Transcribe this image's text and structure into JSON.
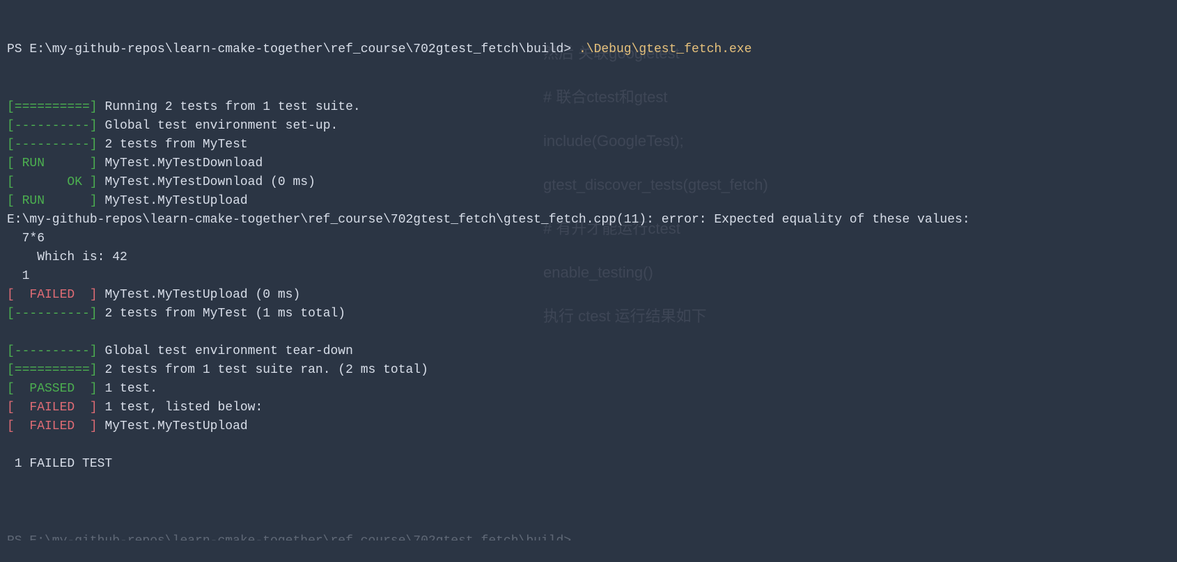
{
  "prompt": {
    "shell": "PS",
    "path": "E:\\my-github-repos\\learn-cmake-together\\ref_course\\702gtest_fetch\\build>",
    "command": ".\\Debug\\gtest_fetch.exe"
  },
  "output": [
    {
      "type": "bracket-green",
      "tag": "[==========] ",
      "text": "Running 2 tests from 1 test suite."
    },
    {
      "type": "bracket-green",
      "tag": "[----------] ",
      "text": "Global test environment set-up."
    },
    {
      "type": "bracket-green",
      "tag": "[----------] ",
      "text": "2 tests from MyTest"
    },
    {
      "type": "status",
      "open": "[ ",
      "status": "RUN",
      "close": "      ] ",
      "statusColor": "green",
      "text": "MyTest.MyTestDownload"
    },
    {
      "type": "status",
      "open": "[       ",
      "status": "OK",
      "close": " ] ",
      "statusColor": "green",
      "text": "MyTest.MyTestDownload (0 ms)"
    },
    {
      "type": "status",
      "open": "[ ",
      "status": "RUN",
      "close": "      ] ",
      "statusColor": "green",
      "text": "MyTest.MyTestUpload"
    },
    {
      "type": "plain",
      "text": "E:\\my-github-repos\\learn-cmake-together\\ref_course\\702gtest_fetch\\gtest_fetch.cpp(11): error: Expected equality of these values:"
    },
    {
      "type": "plain",
      "text": "  7*6"
    },
    {
      "type": "plain",
      "text": "    Which is: 42"
    },
    {
      "type": "plain",
      "text": "  1"
    },
    {
      "type": "status",
      "open": "[  ",
      "status": "FAILED",
      "close": "  ] ",
      "statusColor": "red",
      "text": "MyTest.MyTestUpload (0 ms)"
    },
    {
      "type": "bracket-green",
      "tag": "[----------] ",
      "text": "2 tests from MyTest (1 ms total)"
    },
    {
      "type": "plain",
      "text": ""
    },
    {
      "type": "bracket-green",
      "tag": "[----------] ",
      "text": "Global test environment tear-down"
    },
    {
      "type": "bracket-green",
      "tag": "[==========] ",
      "text": "2 tests from 1 test suite ran. (2 ms total)"
    },
    {
      "type": "status",
      "open": "[  ",
      "status": "PASSED",
      "close": "  ] ",
      "statusColor": "green",
      "text": "1 test."
    },
    {
      "type": "status",
      "open": "[  ",
      "status": "FAILED",
      "close": "  ] ",
      "statusColor": "red",
      "text": "1 test, listed below:"
    },
    {
      "type": "status",
      "open": "[  ",
      "status": "FAILED",
      "close": "  ] ",
      "statusColor": "red",
      "text": "MyTest.MyTestUpload"
    },
    {
      "type": "plain",
      "text": ""
    },
    {
      "type": "plain",
      "text": " 1 FAILED TEST"
    }
  ],
  "partialPrompt": "PS E:\\my-github-repos\\learn-cmake-together\\ref_course\\702gtest_fetch\\build>",
  "ghost": {
    "heading1": "然后 关联googletest",
    "comment1": "# 联合ctest和gtest",
    "code1": "include(GoogleTest);",
    "code2": "gtest_discover_tests(gtest_fetch)",
    "comment2": "# 有开才能运行ctest",
    "code3": "enable_testing()",
    "heading2": "执行 ctest 运行结果如下"
  }
}
